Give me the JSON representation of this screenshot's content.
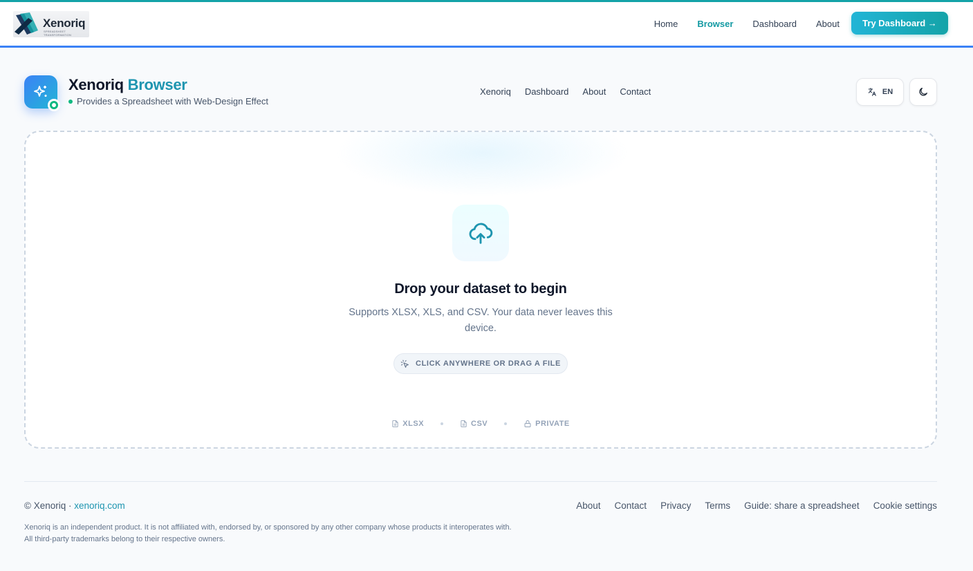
{
  "topbar": {
    "brand": {
      "word": "Xenoriq",
      "sub": "SPREADSHEET TRANSFORMATION"
    },
    "nav": [
      {
        "label": "Home",
        "active": false
      },
      {
        "label": "Browser",
        "active": true
      },
      {
        "label": "Dashboard",
        "active": false
      },
      {
        "label": "About",
        "active": false
      }
    ],
    "cta_label": "Try Dashboard →"
  },
  "app": {
    "title_main": "Xenoriq",
    "title_accent": "Browser",
    "tagline": "Provides a Spreadsheet with Web-Design Effect",
    "subnav": [
      "Xenoriq",
      "Dashboard",
      "About",
      "Contact"
    ],
    "lang_label": "EN"
  },
  "dropzone": {
    "title": "Drop your dataset to begin",
    "description": "Supports XLSX, XLS, and CSV. Your data never leaves this device.",
    "pill_label": "CLICK ANYWHERE OR DRAG A FILE",
    "formats": [
      "XLSX",
      "CSV",
      "PRIVATE"
    ]
  },
  "footer": {
    "copyright_prefix": "© Xenoriq · ",
    "site_link": "xenoriq.com",
    "links": [
      "About",
      "Contact",
      "Privacy",
      "Terms",
      "Guide: share a spreadsheet",
      "Cookie settings"
    ],
    "disclaimer_line1": "Xenoriq is an independent product. It is not affiliated with, endorsed by, or sponsored by any other company whose products it interoperates with.",
    "disclaimer_line2": "All third-party trademarks belong to their respective owners."
  },
  "colors": {
    "accent": "#14a3a8",
    "accent_blue": "#3b82f6",
    "status_green": "#10b981"
  },
  "icons": {
    "app": "sparkles-icon",
    "upload": "cloud-upload-icon",
    "language": "translate-icon",
    "theme": "moon-icon",
    "pointer": "cursor-click-icon",
    "file": "file-icon",
    "lock": "lock-icon"
  }
}
